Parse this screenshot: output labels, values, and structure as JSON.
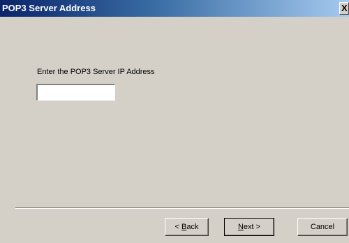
{
  "window": {
    "title": "POP3 Server Address",
    "close_glyph": "X"
  },
  "form": {
    "prompt": "Enter the POP3 Server IP Address",
    "ip_value": ""
  },
  "buttons": {
    "back": {
      "prefix": "< ",
      "mnemonic": "B",
      "rest": "ack"
    },
    "next": {
      "mnemonic": "N",
      "rest": "ext >"
    },
    "cancel": "Cancel"
  },
  "colors": {
    "dialog_bg": "#d4d0c8",
    "title_start": "#0a246a",
    "title_end": "#a6caf0",
    "title_text": "#ffffff"
  }
}
